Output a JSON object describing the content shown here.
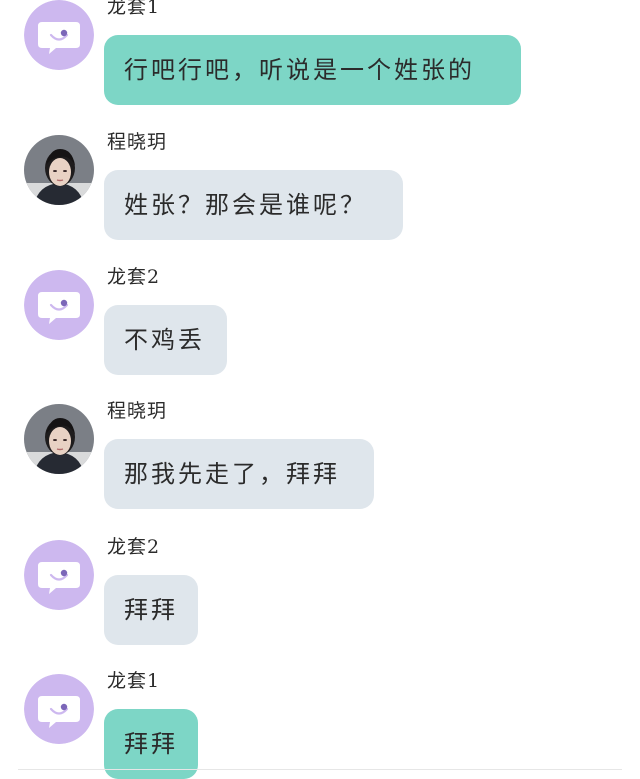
{
  "colors": {
    "bubble_self": "#7dd6c6",
    "bubble_other": "#dfe6ec",
    "bot_avatar": "#cdb8ef"
  },
  "messages": [
    {
      "sender": "龙套1",
      "avatar": "bot-avatar-icon",
      "text": "行吧行吧，听说是一个姓张的",
      "style": "teal"
    },
    {
      "sender": "程晓玥",
      "avatar": "girl-avatar",
      "text": "姓张？那会是谁呢？",
      "style": "grey"
    },
    {
      "sender": "龙套2",
      "avatar": "bot-avatar-icon",
      "text": "不鸡丢",
      "style": "grey"
    },
    {
      "sender": "程晓玥",
      "avatar": "girl-avatar",
      "text": "那我先走了，拜拜",
      "style": "grey"
    },
    {
      "sender": "龙套2",
      "avatar": "bot-avatar-icon",
      "text": "拜拜",
      "style": "grey"
    },
    {
      "sender": "龙套1",
      "avatar": "bot-avatar-icon",
      "text": "拜拜",
      "style": "teal"
    }
  ]
}
